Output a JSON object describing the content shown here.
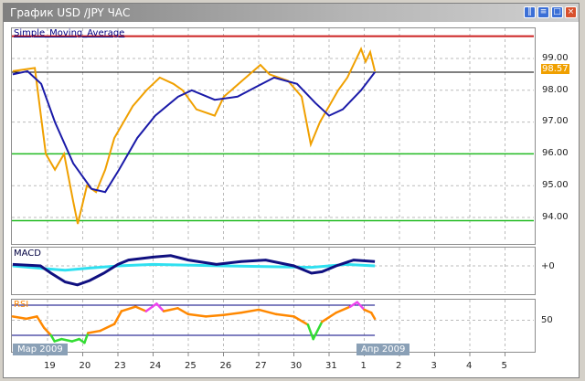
{
  "window": {
    "title": "График USD /JPY  ЧАС",
    "buttons": [
      "tile",
      "list",
      "maximize",
      "close"
    ]
  },
  "main_pane": {
    "indicator_label": "Simple_Moving_Average",
    "price_labels": [
      "99.00",
      "98.00",
      "97.00",
      "96.00",
      "95.00",
      "94.00"
    ],
    "current_price": "98.57"
  },
  "macd_pane": {
    "label": "MACD",
    "axis_label": "+0"
  },
  "rsi_pane": {
    "label": "RSI",
    "axis_label": "50"
  },
  "x_axis": {
    "labels": [
      "19",
      "20",
      "23",
      "24",
      "25",
      "26",
      "27",
      "30",
      "31",
      "1",
      "2",
      "3",
      "4",
      "5"
    ],
    "month_tags": [
      "Мар 2009",
      "Апр 2009"
    ]
  },
  "colors": {
    "price": "#f0a000",
    "sma": "#1a1aa8",
    "resistance": "#cc2222",
    "support": "#22bb22",
    "macd": "#101080",
    "signal": "#30e0f0",
    "rsi": "#ff8800",
    "rsi_low": "#33dd33",
    "rsi_high": "#ee44ee"
  },
  "chart_data": {
    "type": "line",
    "x_unit": "trading-day index (0 = Mar 19)",
    "price": {
      "ylim": [
        93.6,
        99.8
      ],
      "levels": {
        "resistance": 99.7,
        "support": [
          96.0,
          93.9
        ],
        "last": 98.57
      },
      "series": [
        [
          -0.99,
          98.6
        ],
        [
          -0.36,
          98.7
        ],
        [
          -0.05,
          96.0
        ],
        [
          0.21,
          95.5
        ],
        [
          0.47,
          96.0
        ],
        [
          0.73,
          94.5
        ],
        [
          0.86,
          93.8
        ],
        [
          1.12,
          95.0
        ],
        [
          1.38,
          94.8
        ],
        [
          1.64,
          95.5
        ],
        [
          1.9,
          96.5
        ],
        [
          2.16,
          97.0
        ],
        [
          2.42,
          97.5
        ],
        [
          2.81,
          98.0
        ],
        [
          3.19,
          98.4
        ],
        [
          3.58,
          98.2
        ],
        [
          3.84,
          98.0
        ],
        [
          4.23,
          97.4
        ],
        [
          4.75,
          97.2
        ],
        [
          5.01,
          97.8
        ],
        [
          5.53,
          98.3
        ],
        [
          6.05,
          98.8
        ],
        [
          6.31,
          98.5
        ],
        [
          6.83,
          98.3
        ],
        [
          7.22,
          97.8
        ],
        [
          7.48,
          96.3
        ],
        [
          7.74,
          97.0
        ],
        [
          8.0,
          97.5
        ],
        [
          8.26,
          98.0
        ],
        [
          8.52,
          98.4
        ],
        [
          8.78,
          99.0
        ],
        [
          8.91,
          99.3
        ],
        [
          9.04,
          98.9
        ],
        [
          9.17,
          99.2
        ],
        [
          9.3,
          98.6
        ]
      ],
      "sma": [
        [
          -0.99,
          98.5
        ],
        [
          -0.57,
          98.6
        ],
        [
          -0.18,
          98.2
        ],
        [
          0.21,
          97.0
        ],
        [
          0.73,
          95.7
        ],
        [
          1.25,
          94.9
        ],
        [
          1.64,
          94.8
        ],
        [
          2.03,
          95.5
        ],
        [
          2.55,
          96.5
        ],
        [
          3.06,
          97.2
        ],
        [
          3.71,
          97.8
        ],
        [
          4.1,
          98.0
        ],
        [
          4.75,
          97.7
        ],
        [
          5.4,
          97.8
        ],
        [
          5.92,
          98.1
        ],
        [
          6.44,
          98.4
        ],
        [
          7.09,
          98.2
        ],
        [
          7.61,
          97.6
        ],
        [
          8.0,
          97.2
        ],
        [
          8.39,
          97.4
        ],
        [
          8.91,
          98.0
        ],
        [
          9.3,
          98.57
        ]
      ]
    },
    "macd": {
      "main": [
        [
          -0.99,
          0.1
        ],
        [
          -0.2,
          0
        ],
        [
          0.1,
          -0.5
        ],
        [
          0.5,
          -1.1
        ],
        [
          0.85,
          -1.3
        ],
        [
          1.2,
          -1.0
        ],
        [
          1.6,
          -0.5
        ],
        [
          2.0,
          0.1
        ],
        [
          2.3,
          0.4
        ],
        [
          3.0,
          0.6
        ],
        [
          3.5,
          0.7
        ],
        [
          4.0,
          0.4
        ],
        [
          4.8,
          0.1
        ],
        [
          5.5,
          0.3
        ],
        [
          6.2,
          0.4
        ],
        [
          7.0,
          0.0
        ],
        [
          7.5,
          -0.5
        ],
        [
          7.8,
          -0.4
        ],
        [
          8.2,
          0.0
        ],
        [
          8.7,
          0.4
        ],
        [
          9.3,
          0.3
        ]
      ],
      "signal": [
        [
          -0.99,
          0
        ],
        [
          0,
          -0.2
        ],
        [
          0.5,
          -0.3
        ],
        [
          1.2,
          -0.15
        ],
        [
          2,
          0
        ],
        [
          3,
          0.1
        ],
        [
          5,
          0
        ],
        [
          7.5,
          -0.1
        ],
        [
          8.5,
          0.1
        ],
        [
          9.3,
          0
        ]
      ]
    },
    "rsi": {
      "levels": [
        70,
        30
      ],
      "series": [
        [
          -0.99,
          55
        ],
        [
          -0.6,
          52
        ],
        [
          -0.3,
          55
        ],
        [
          -0.1,
          40
        ],
        [
          0.1,
          30
        ],
        [
          0.2,
          22
        ],
        [
          0.4,
          25
        ],
        [
          0.7,
          22
        ],
        [
          0.9,
          25
        ],
        [
          1.05,
          20
        ],
        [
          1.15,
          33
        ],
        [
          1.5,
          36
        ],
        [
          1.9,
          45
        ],
        [
          2.1,
          62
        ],
        [
          2.5,
          68
        ],
        [
          2.8,
          62
        ],
        [
          3.1,
          72
        ],
        [
          3.3,
          62
        ],
        [
          3.7,
          66
        ],
        [
          4.0,
          58
        ],
        [
          4.5,
          55
        ],
        [
          5,
          57
        ],
        [
          5.5,
          60
        ],
        [
          6,
          64
        ],
        [
          6.5,
          58
        ],
        [
          7,
          55
        ],
        [
          7.4,
          44
        ],
        [
          7.55,
          25
        ],
        [
          7.8,
          48
        ],
        [
          8.2,
          60
        ],
        [
          8.6,
          68
        ],
        [
          8.8,
          74
        ],
        [
          9.0,
          64
        ],
        [
          9.2,
          60
        ],
        [
          9.3,
          52
        ]
      ]
    }
  }
}
